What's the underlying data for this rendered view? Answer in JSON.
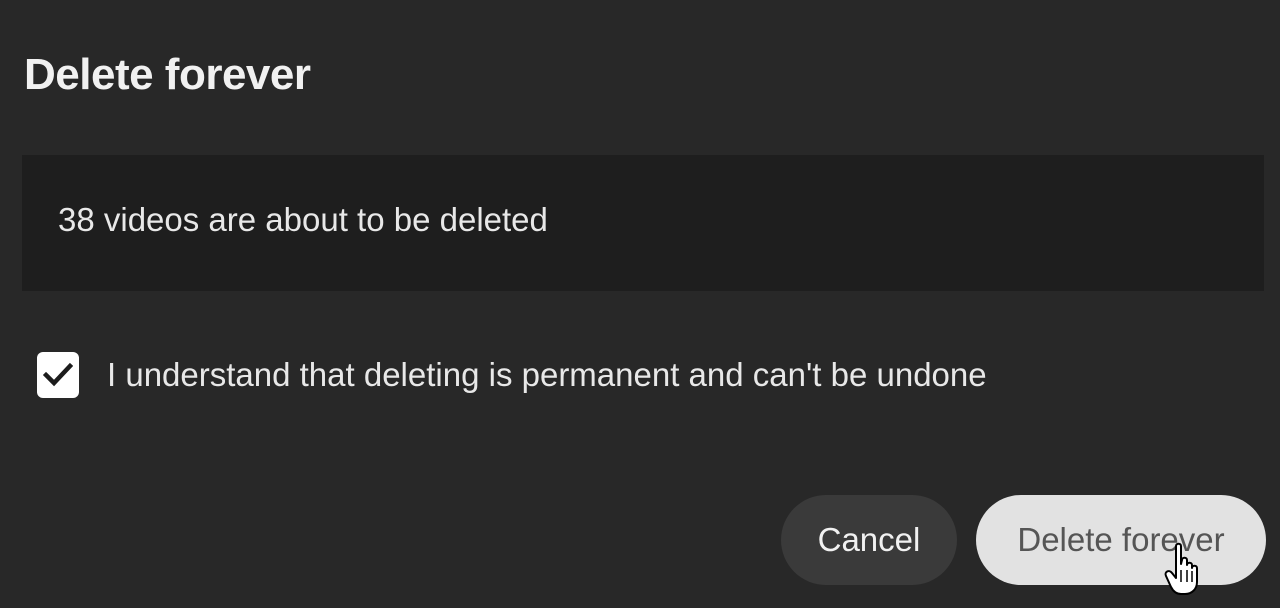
{
  "dialog": {
    "title": "Delete forever",
    "message": "38 videos are about to be deleted",
    "confirm": {
      "label": "I understand that deleting is permanent and can't be undone",
      "checked": true
    },
    "buttons": {
      "cancel_label": "Cancel",
      "delete_label": "Delete forever"
    }
  },
  "colors": {
    "background": "#282828",
    "message_box": "#1e1e1e",
    "checkbox": "#ffffff",
    "cancel_button": "#3a3a3a",
    "delete_button": "#e2e2e2"
  },
  "icons": {
    "checkbox": "checkmark-icon",
    "cursor": "hand-pointer-icon"
  }
}
